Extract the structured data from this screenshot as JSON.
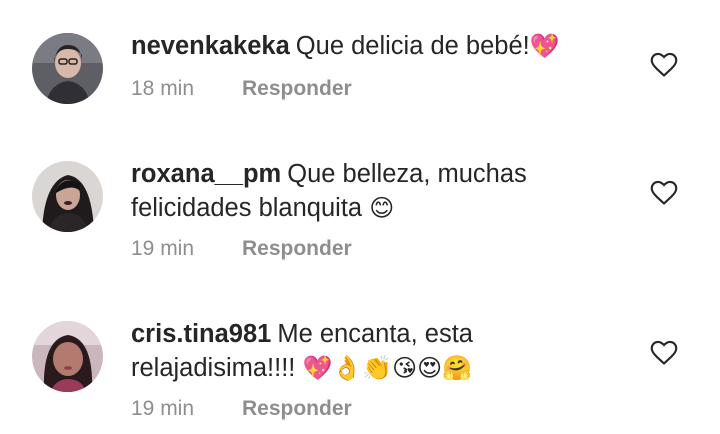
{
  "comments": [
    {
      "username": "nevenkakeka",
      "text": "Que delicia de bebé!",
      "emojis": "💖",
      "time": "18 min",
      "reply_label": "Responder",
      "avatar_bg": "#6d6d73"
    },
    {
      "username": "roxana__pm",
      "text": "Que belleza, muchas felicidades blanquita",
      "emojis": "😊",
      "time": "19 min",
      "reply_label": "Responder",
      "avatar_bg": "#4a4546"
    },
    {
      "username": "cris.tina981",
      "text": "Me encanta, esta relajadisima!!!!",
      "emojis": "💖👌👏😘😍🤗",
      "time": "19 min",
      "reply_label": "Responder",
      "avatar_bg": "#b05a63"
    }
  ],
  "icons": {
    "like": "heart-outline-icon"
  },
  "colors": {
    "meta": "#8e8e8e",
    "text": "#262626",
    "heart": "#262626"
  }
}
